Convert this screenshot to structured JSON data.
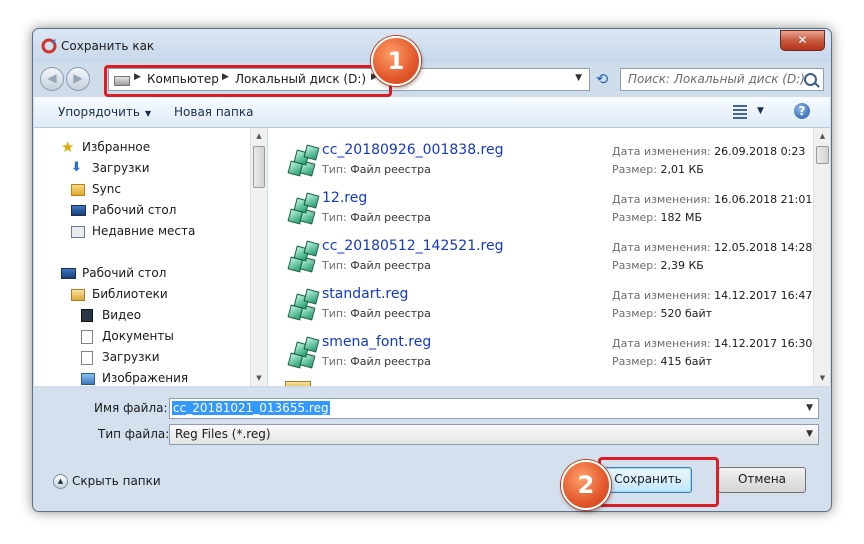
{
  "window": {
    "title": "Сохранить как",
    "close_glyph": "✕"
  },
  "nav": {
    "back_glyph": "◀",
    "forward_glyph": "▶"
  },
  "address": {
    "crumbs": [
      "Компьютер",
      "Локальный диск (D:)"
    ],
    "sep_glyph": "▶",
    "drop_glyph": "▼",
    "refresh_glyph": "⟲"
  },
  "search": {
    "placeholder": "Поиск: Локальный диск (D:)"
  },
  "toolbar": {
    "organize_label": "Упорядочить",
    "new_folder_label": "Новая папка",
    "caret_glyph": "▼",
    "help_glyph": "?"
  },
  "sidebar": {
    "items": [
      {
        "label": "Избранное",
        "icon": "star-icon"
      },
      {
        "label": "Загрузки",
        "icon": "downloads-icon"
      },
      {
        "label": "Sync",
        "icon": "folder-icon"
      },
      {
        "label": "Рабочий стол",
        "icon": "desktop-icon"
      },
      {
        "label": "Недавние места",
        "icon": "recent-places-icon"
      },
      {
        "label": "Рабочий стол",
        "icon": "desktop-icon"
      },
      {
        "label": "Библиотеки",
        "icon": "libraries-icon"
      },
      {
        "label": "Видео",
        "icon": "video-icon"
      },
      {
        "label": "Документы",
        "icon": "documents-icon"
      },
      {
        "label": "Загрузки",
        "icon": "downloads-library-icon"
      },
      {
        "label": "Изображения",
        "icon": "images-icon"
      }
    ]
  },
  "files": {
    "type_label": "Тип:",
    "modified_label": "Дата изменения:",
    "size_label": "Размер:",
    "items": [
      {
        "name": "cc_20180926_001838.reg",
        "type": "Файл реестра",
        "modified": "26.09.2018 0:23",
        "size": "2,01 КБ"
      },
      {
        "name": "12.reg",
        "type": "Файл реестра",
        "modified": "16.06.2018 21:01",
        "size": "182 МБ"
      },
      {
        "name": "cc_20180512_142521.reg",
        "type": "Файл реестра",
        "modified": "12.05.2018 14:28",
        "size": "2,39 КБ"
      },
      {
        "name": "standart.reg",
        "type": "Файл реестра",
        "modified": "14.12.2017 16:47",
        "size": "520 байт"
      },
      {
        "name": "smena_font.reg",
        "type": "Файл реестра",
        "modified": "14.12.2017 16:30",
        "size": "415 байт"
      }
    ]
  },
  "form": {
    "filename_label": "Имя файла:",
    "filename_value": "cc_20181021_013655.reg",
    "filetype_label": "Тип файла:",
    "filetype_value": "Reg Files (*.reg)",
    "drop_glyph": "▼"
  },
  "footer": {
    "hide_folders_label": "Скрыть папки",
    "hide_glyph": "▲",
    "save_label": "Сохранить",
    "cancel_label": "Отмена"
  },
  "callouts": {
    "first": "1",
    "second": "2",
    "color": "#d91e26"
  },
  "scroll": {
    "up_glyph": "▲",
    "down_glyph": "▼"
  }
}
